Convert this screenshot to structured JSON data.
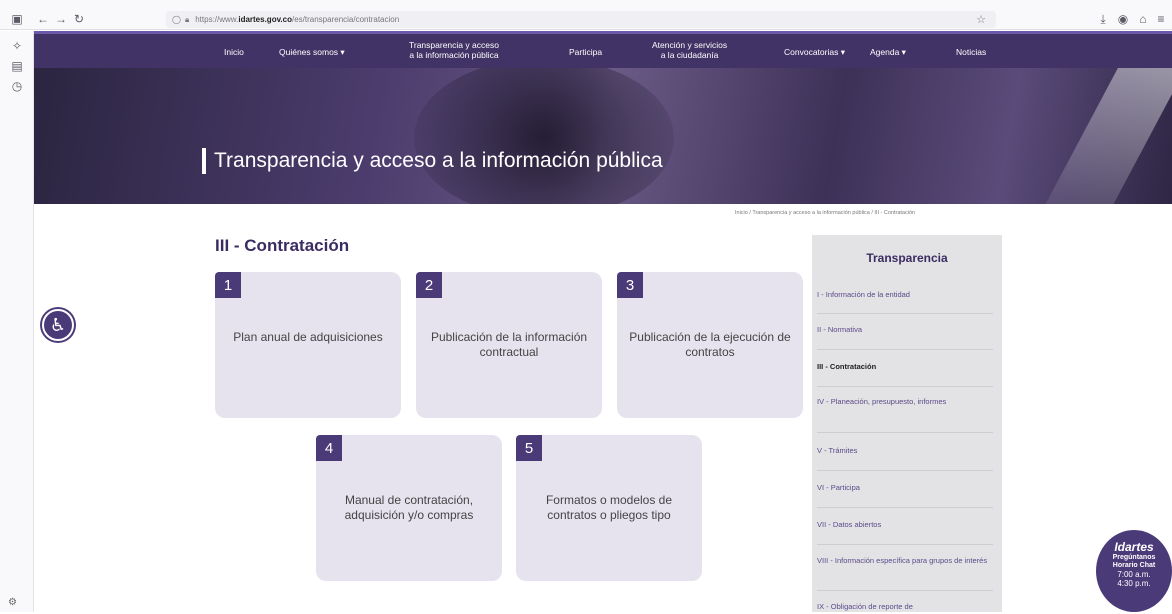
{
  "browser": {
    "url_prefix": "https://www.",
    "url_domain": "idartes.gov.co",
    "url_path": "/es/transparencia/contratacion",
    "icons": [
      "sidebar-toggle-icon",
      "back-icon",
      "forward-icon",
      "reload-icon",
      "shield-icon",
      "lock-icon",
      "star-icon",
      "download-icon",
      "account-icon",
      "extensions-icon",
      "menu-icon"
    ]
  },
  "nav": {
    "items": [
      {
        "label": "Inicio"
      },
      {
        "label": "Quiénes somos ▾"
      },
      {
        "label": "Transparencia y acceso\na la información pública"
      },
      {
        "label": "Participa"
      },
      {
        "label": "Atención y servicios\na la ciudadanía"
      },
      {
        "label": "Convocatorias ▾"
      },
      {
        "label": "Agenda ▾"
      },
      {
        "label": "Noticias"
      }
    ]
  },
  "hero": {
    "title": "Transparencia y acceso a la información pública"
  },
  "breadcrumb": {
    "text": "Inicio  /  Transparencia y acceso a la información pública  /  III - Contratación"
  },
  "main": {
    "title": "III - Contratación",
    "cards": [
      {
        "num": "1",
        "label": "Plan anual de adquisiciones"
      },
      {
        "num": "2",
        "label": "Publicación de la información contractual"
      },
      {
        "num": "3",
        "label": "Publicación de la ejecución de contratos"
      },
      {
        "num": "4",
        "label": "Manual de contratación, adquisición y/o compras"
      },
      {
        "num": "5",
        "label": "Formatos o modelos de contratos o pliegos tipo"
      }
    ]
  },
  "panel": {
    "title": "Transparencia",
    "items": [
      {
        "label": "I - Información de la entidad"
      },
      {
        "label": "II - Normativa"
      },
      {
        "label": "III - Contratación"
      },
      {
        "label": "IV - Planeación, presupuesto, informes"
      },
      {
        "label": "V - Trámites"
      },
      {
        "label": "VI - Participa"
      },
      {
        "label": "VII - Datos abiertos"
      },
      {
        "label": "VIII - Información específica para grupos de interés"
      },
      {
        "label": "IX - Obligación de reporte de"
      }
    ]
  },
  "chat": {
    "brand": "Idartes",
    "l1": "Pregúntanos",
    "l2": "Horario Chat",
    "t1": "7:00 a.m.",
    "t2": "4:30 p.m."
  },
  "colors": {
    "brand": "#413365",
    "accent": "#4b3a78",
    "card_bg": "#e6e3ee",
    "panel_bg": "#e3e2e4"
  }
}
